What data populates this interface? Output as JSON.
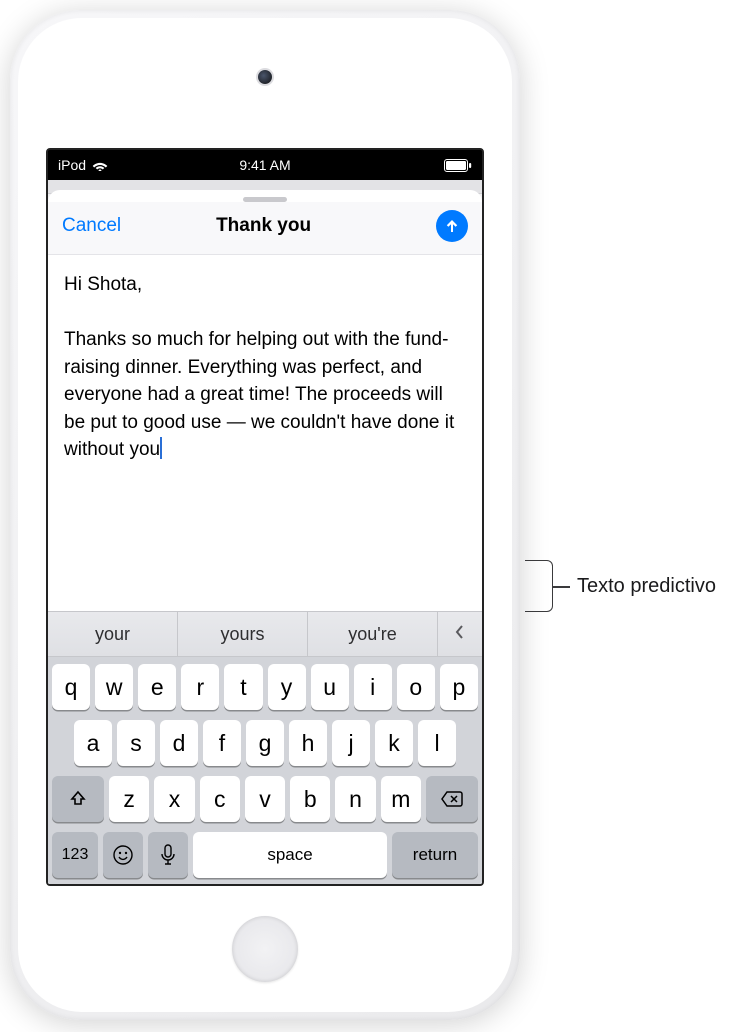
{
  "status": {
    "carrier": "iPod",
    "time": "9:41 AM"
  },
  "compose": {
    "cancel_label": "Cancel",
    "title": "Thank you",
    "body": "Hi Shota,\n\nThanks so much for helping out with the fund-raising dinner. Everything was perfect, and everyone had a great time! The proceeds will be put to good use — we couldn't have done it without you"
  },
  "predictive": {
    "options": [
      "your",
      "yours",
      "you're"
    ]
  },
  "keyboard": {
    "row1": [
      "q",
      "w",
      "e",
      "r",
      "t",
      "y",
      "u",
      "i",
      "o",
      "p"
    ],
    "row2": [
      "a",
      "s",
      "d",
      "f",
      "g",
      "h",
      "j",
      "k",
      "l"
    ],
    "row3": [
      "z",
      "x",
      "c",
      "v",
      "b",
      "n",
      "m"
    ],
    "numbers_label": "123",
    "space_label": "space",
    "return_label": "return"
  },
  "callout": {
    "label": "Texto predictivo"
  }
}
